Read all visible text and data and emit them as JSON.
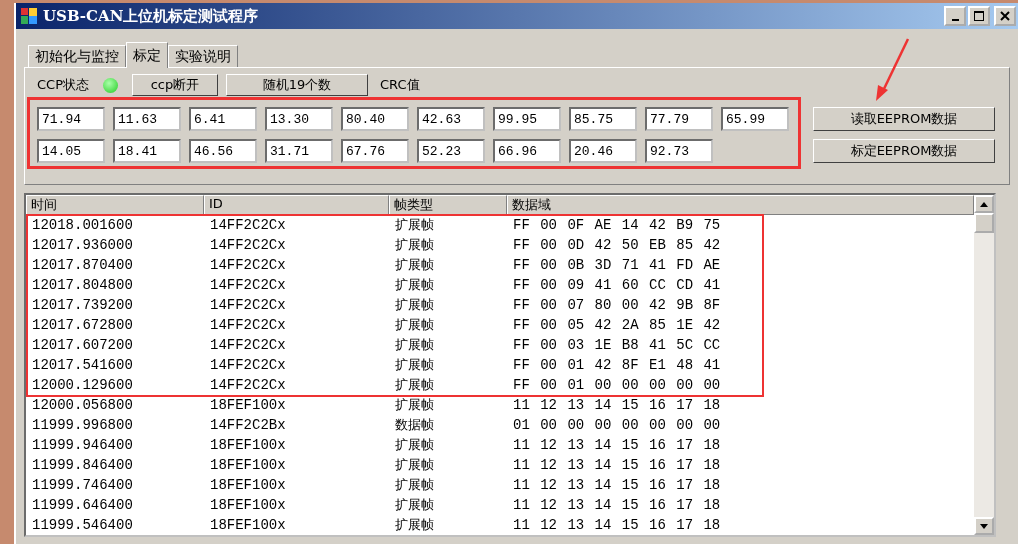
{
  "window": {
    "title": "USB-CAN上位机标定测试程序"
  },
  "tabs": [
    {
      "label": "初始化与监控",
      "selected": false
    },
    {
      "label": "标定",
      "selected": true
    },
    {
      "label": "实验说明",
      "selected": false
    }
  ],
  "ccp_status": {
    "label": "CCP状态",
    "on": true
  },
  "top_buttons": [
    "ccp断开",
    "随机19个数"
  ],
  "crc_label": "CRC值",
  "value_rows": [
    [
      "71.94",
      "11.63",
      "6.41",
      "13.30",
      "80.40",
      "42.63",
      "99.95",
      "85.75",
      "77.79",
      "65.99"
    ],
    [
      "14.05",
      "18.41",
      "46.56",
      "31.71",
      "67.76",
      "52.23",
      "66.96",
      "20.46",
      "92.73"
    ]
  ],
  "side_buttons": [
    "读取EEPROM数据",
    "标定EEPROM数据"
  ],
  "table": {
    "columns": [
      "时间",
      "ID",
      "帧类型",
      "数据域"
    ],
    "rows": [
      [
        "12018.001600",
        "14FF2C2Cx",
        "扩展帧",
        "FF 00 0F AE 14 42 B9 75"
      ],
      [
        "12017.936000",
        "14FF2C2Cx",
        "扩展帧",
        "FF 00 0D 42 50 EB 85 42"
      ],
      [
        "12017.870400",
        "14FF2C2Cx",
        "扩展帧",
        "FF 00 0B 3D 71 41 FD AE"
      ],
      [
        "12017.804800",
        "14FF2C2Cx",
        "扩展帧",
        "FF 00 09 41 60 CC CD 41"
      ],
      [
        "12017.739200",
        "14FF2C2Cx",
        "扩展帧",
        "FF 00 07 80 00 42 9B 8F"
      ],
      [
        "12017.672800",
        "14FF2C2Cx",
        "扩展帧",
        "FF 00 05 42 2A 85 1E 42"
      ],
      [
        "12017.607200",
        "14FF2C2Cx",
        "扩展帧",
        "FF 00 03 1E B8 41 5C CC"
      ],
      [
        "12017.541600",
        "14FF2C2Cx",
        "扩展帧",
        "FF 00 01 42 8F E1 48 41"
      ],
      [
        "12000.129600",
        "14FF2C2Cx",
        "扩展帧",
        "FF 00 01 00 00 00 00 00"
      ],
      [
        "12000.056800",
        "18FEF100x",
        "扩展帧",
        "11 12 13 14 15 16 17 18"
      ],
      [
        "11999.996800",
        "14FF2C2Bx",
        "数据帧",
        "01 00 00 00 00 00 00 00"
      ],
      [
        "11999.946400",
        "18FEF100x",
        "扩展帧",
        "11 12 13 14 15 16 17 18"
      ],
      [
        "11999.846400",
        "18FEF100x",
        "扩展帧",
        "11 12 13 14 15 16 17 18"
      ],
      [
        "11999.746400",
        "18FEF100x",
        "扩展帧",
        "11 12 13 14 15 16 17 18"
      ],
      [
        "11999.646400",
        "18FEF100x",
        "扩展帧",
        "11 12 13 14 15 16 17 18"
      ],
      [
        "11999.546400",
        "18FEF100x",
        "扩展帧",
        "11 12 13 14 15 16 17 18"
      ]
    ]
  }
}
